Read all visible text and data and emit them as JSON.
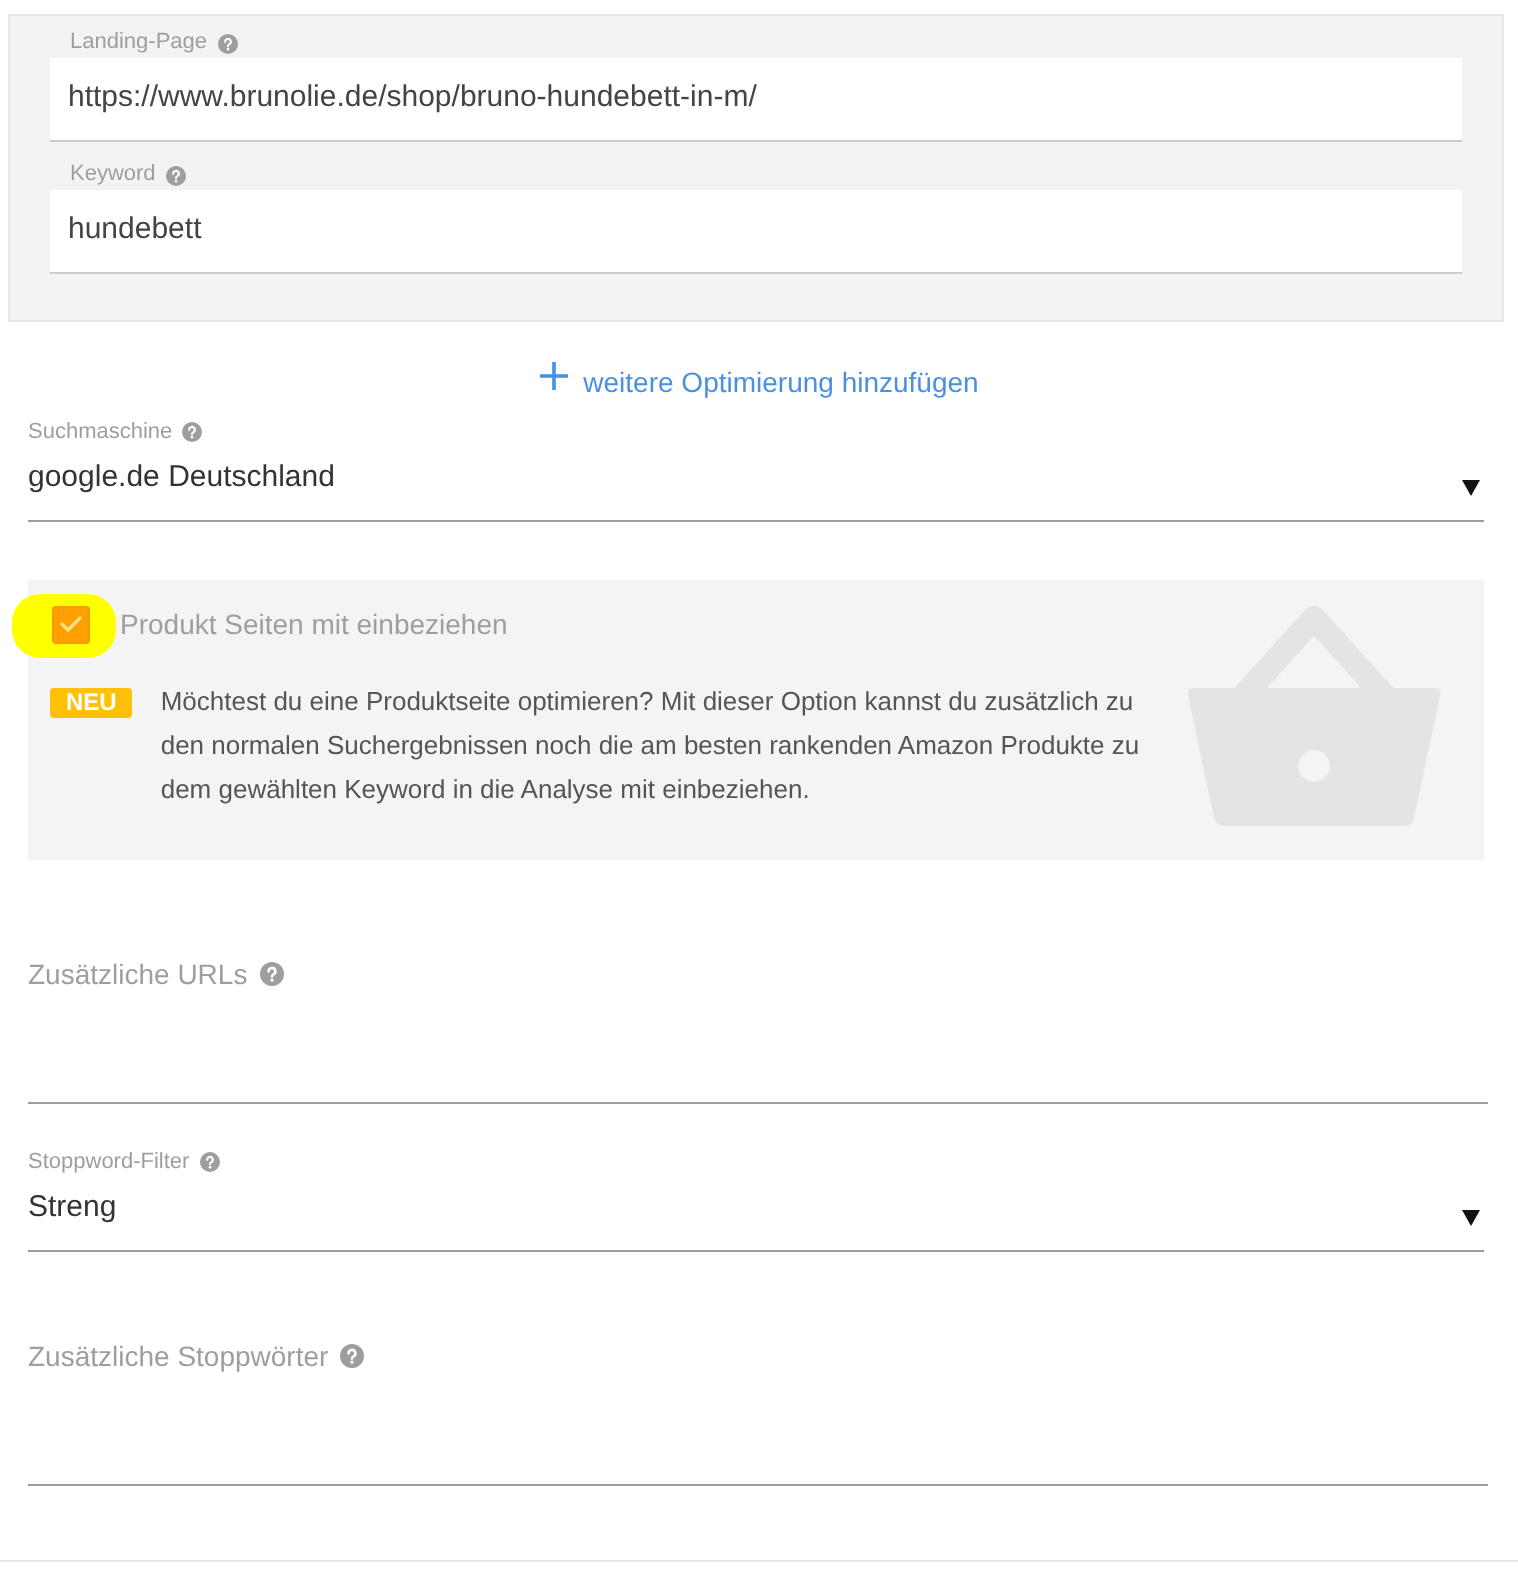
{
  "optimization": {
    "fields": [
      {
        "label": "Landing-Page",
        "value": "https://www.brunolie.de/shop/bruno-hundebett-in-m/"
      },
      {
        "label": "Keyword",
        "value": "hundebett"
      }
    ]
  },
  "add_optimization": {
    "label": "weitere Optimierung hinzufügen"
  },
  "settings": [
    {
      "kind": "select",
      "label": "Suchmaschine",
      "value": "google.de Deutschland"
    },
    {
      "kind": "checkbox_panel",
      "label": "Produkt Seiten mit einbeziehen",
      "checked": true,
      "highlighted": true,
      "badge": "NEU",
      "description": "Möchtest du eine Produktseite optimieren? Mit dieser Option kannst du zusätzlich zu den normalen Suchergebnissen noch die am besten rankenden Amazon Produkte zu dem gewählten Keyword in die Analyse mit einbeziehen."
    },
    {
      "kind": "textarea",
      "label": "Zusätzliche URLs"
    },
    {
      "kind": "select",
      "label": "Stoppword-Filter",
      "value": "Streng"
    },
    {
      "kind": "textarea",
      "label": "Zusätzliche Stoppwörter"
    }
  ]
}
